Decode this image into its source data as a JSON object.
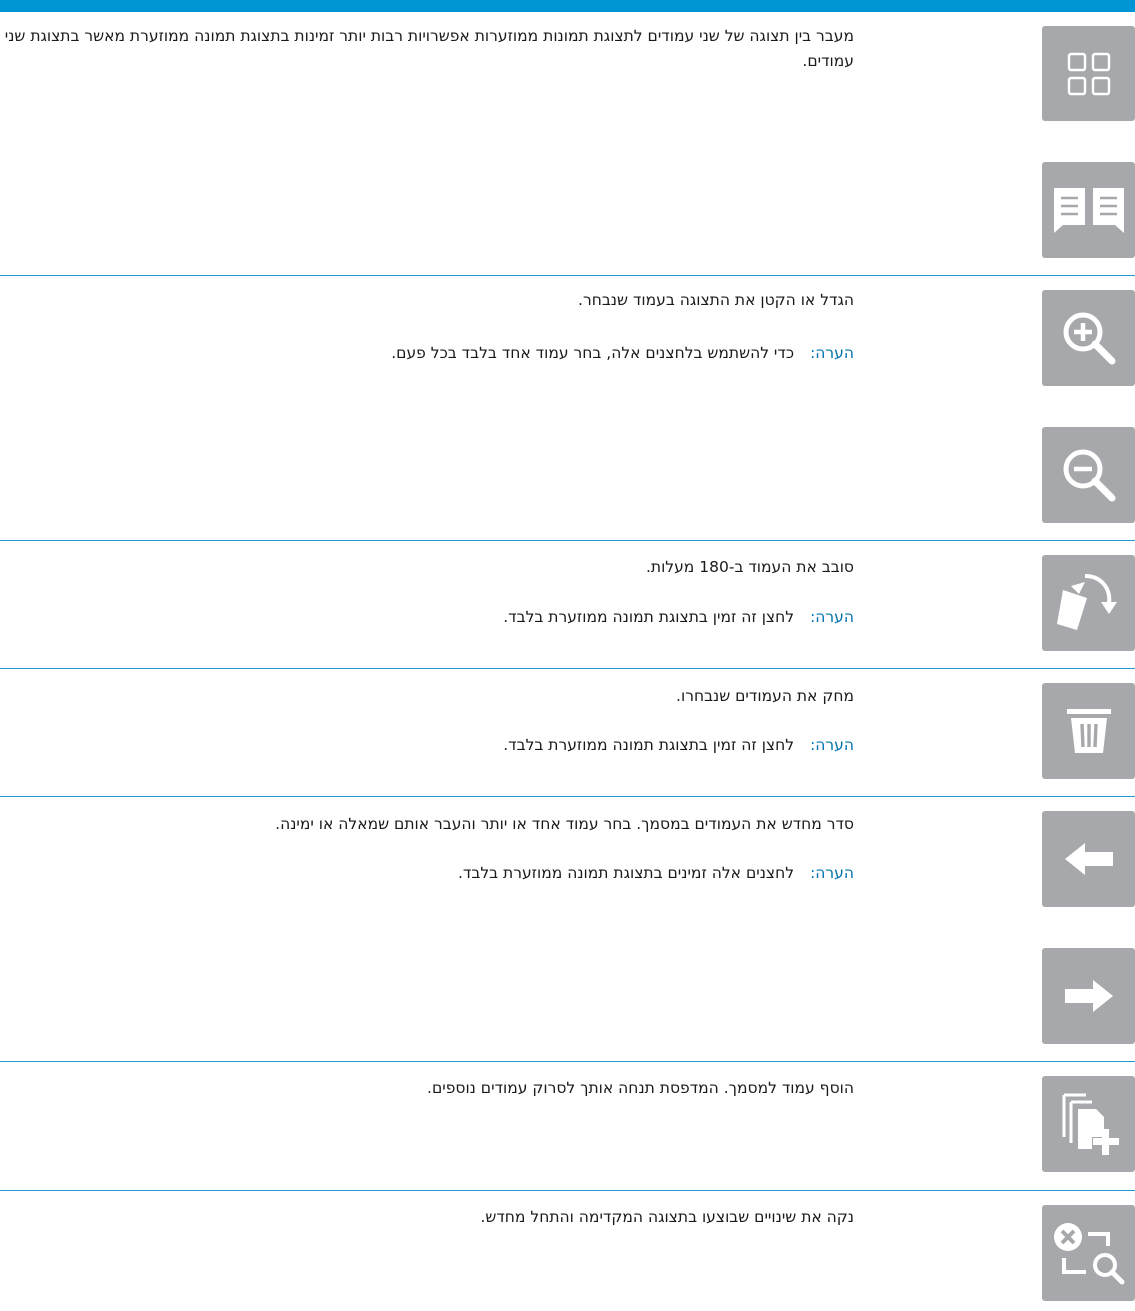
{
  "colors": {
    "accent_bar": "#0096d6",
    "separator": "#1f9bd0",
    "note_label": "#0073b0",
    "button_bg": "#a6a8ab"
  },
  "rows": [
    {
      "description": "מעבר בין תצוגה של שני עמודים לתצוגת תמונות ממוזערות אפשרויות רבות יותר זמינות בתצוגת תמונה ממוזערת מאשר בתצוגת שני עמודים.",
      "icons": [
        "thumbnail-grid-icon",
        "two-page-view-icon"
      ]
    },
    {
      "description": "הגדל או הקטן את התצוגה בעמוד שנבחר.",
      "note_label": "הערה:",
      "note_text": "כדי להשתמש בלחצנים אלה, בחר עמוד אחד בלבד בכל פעם.",
      "icons": [
        "zoom-in-icon",
        "zoom-out-icon"
      ]
    },
    {
      "description": "סובב את העמוד ב-180 מעלות.",
      "note_label": "הערה:",
      "note_text": "לחצן זה זמין בתצוגת תמונה ממוזערת בלבד.",
      "icons": [
        "rotate-page-icon"
      ]
    },
    {
      "description": "מחק את העמודים שנבחרו.",
      "note_label": "הערה:",
      "note_text": "לחצן זה זמין בתצוגת תמונה ממוזערת בלבד.",
      "icons": [
        "trash-icon"
      ]
    },
    {
      "description": "סדר מחדש את העמודים במסמך. בחר עמוד אחד או יותר והעבר אותם שמאלה או ימינה.",
      "note_label": "הערה:",
      "note_text": "לחצנים אלה זמינים בתצוגת תמונה ממוזערת בלבד.",
      "icons": [
        "arrow-left-icon",
        "arrow-right-icon"
      ]
    },
    {
      "description": "הוסף עמוד למסמך. המדפסת תנחה אותך לסרוק עמודים נוספים.",
      "icons": [
        "add-page-icon"
      ]
    },
    {
      "description": "נקה את שינויים שבוצעו בתצוגה המקדימה והתחל מחדש.",
      "icons": [
        "reset-preview-icon"
      ]
    }
  ]
}
